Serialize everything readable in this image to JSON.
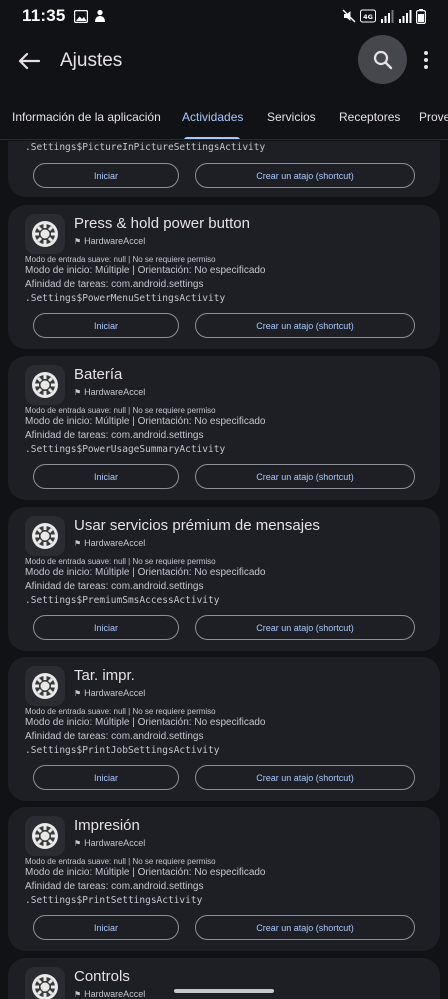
{
  "status": {
    "time": "11:35",
    "left_icons": [
      "image-icon",
      "gesture-icon"
    ],
    "right_icons": [
      "mute-icon",
      "volte-icon",
      "signal-icon",
      "signal-icon",
      "battery-icon"
    ]
  },
  "app_bar": {
    "title": "Ajustes"
  },
  "tabs": [
    "Información de la aplicación",
    "Actividades",
    "Servicios",
    "Receptores",
    "Proveedores"
  ],
  "active_tab": "Actividades",
  "top_card": {
    "activity": ".Settings$PictureInPictureSettingsActivity",
    "start_label": "Iniciar",
    "shortcut_label": "Crear un atajo (shortcut)"
  },
  "cards": [
    {
      "title": "Press & hold power button",
      "tag": "HardwareAccel",
      "soft_input": "Modo de entrada suave: null | No se requiere permiso",
      "launch_mode": "Modo de inicio: Múltiple | Orientación: No especificado",
      "affinity": "Afinidad de tareas: com.android.settings",
      "activity": ".Settings$PowerMenuSettingsActivity",
      "start_label": "Iniciar",
      "shortcut_label": "Crear un atajo (shortcut)"
    },
    {
      "title": "Batería",
      "tag": "HardwareAccel",
      "soft_input": "Modo de entrada suave: null | No se requiere permiso",
      "launch_mode": "Modo de inicio: Múltiple | Orientación: No especificado",
      "affinity": "Afinidad de tareas: com.android.settings",
      "activity": ".Settings$PowerUsageSummaryActivity",
      "start_label": "Iniciar",
      "shortcut_label": "Crear un atajo (shortcut)"
    },
    {
      "title": "Usar servicios prémium de mensajes",
      "tag": "HardwareAccel",
      "soft_input": "Modo de entrada suave: null | No se requiere permiso",
      "launch_mode": "Modo de inicio: Múltiple | Orientación: No especificado",
      "affinity": "Afinidad de tareas: com.android.settings",
      "activity": ".Settings$PremiumSmsAccessActivity",
      "start_label": "Iniciar",
      "shortcut_label": "Crear un atajo (shortcut)"
    },
    {
      "title": "Tar. impr.",
      "tag": "HardwareAccel",
      "soft_input": "Modo de entrada suave: null | No se requiere permiso",
      "launch_mode": "Modo de inicio: Múltiple | Orientación: No especificado",
      "affinity": "Afinidad de tareas: com.android.settings",
      "activity": ".Settings$PrintJobSettingsActivity",
      "start_label": "Iniciar",
      "shortcut_label": "Crear un atajo (shortcut)"
    },
    {
      "title": "Impresión",
      "tag": "HardwareAccel",
      "soft_input": "Modo de entrada suave: null | No se requiere permiso",
      "launch_mode": "Modo de inicio: Múltiple | Orientación: No especificado",
      "affinity": "Afinidad de tareas: com.android.settings",
      "activity": ".Settings$PrintSettingsActivity",
      "start_label": "Iniciar",
      "shortcut_label": "Crear un atajo (shortcut)"
    },
    {
      "title": "Controls",
      "tag": "HardwareAccel"
    }
  ],
  "colors": {
    "background": "#111216",
    "card": "#1e1f24",
    "accent": "#a8c7fa",
    "search_button": "#45474d"
  }
}
